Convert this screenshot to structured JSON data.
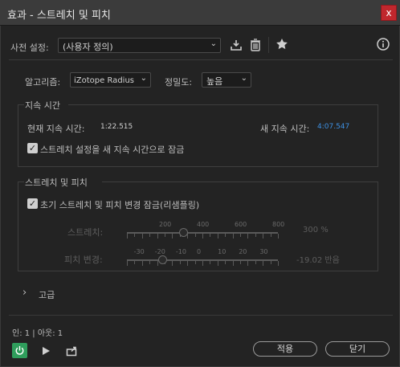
{
  "window": {
    "title": "효과 - 스트레치 및 피치",
    "close_glyph": "x"
  },
  "preset": {
    "label": "사전 설정:",
    "value": "(사용자 정의)"
  },
  "algorithm": {
    "label": "알고리즘:",
    "value": "iZotope Radius"
  },
  "precision": {
    "label": "정밀도:",
    "value": "높음"
  },
  "duration": {
    "group_title": "지속 시간",
    "current_label": "현재 지속 시간:",
    "current_value": "1:22.515",
    "new_label": "새 지속 시간:",
    "new_value": "4:07.547",
    "lock_label": "스트레치 설정을 새 지속 시간으로 잠금",
    "lock_checked": true
  },
  "stretch_pitch": {
    "group_title": "스트레치 및 피치",
    "lock_label": "초기 스트레치 및 피치 변경 잠금(리샘플링)",
    "lock_checked": true,
    "stretch": {
      "label": "스트레치:",
      "scale": [
        "200",
        "400",
        "600",
        "800"
      ],
      "value_text": "300 %",
      "value": 300,
      "min": 0,
      "max": 800
    },
    "pitch": {
      "label": "피치 변경:",
      "scale": [
        "-30",
        "-20",
        "-10",
        "0",
        "10",
        "20",
        "30"
      ],
      "value_text": "-19.02 반음",
      "value": -19.02,
      "min": -36,
      "max": 36
    }
  },
  "advanced": {
    "label": "고급",
    "chevron": "›"
  },
  "io": {
    "label": "인: 1 | 아웃: 1"
  },
  "buttons": {
    "apply": "적용",
    "close": "닫기"
  },
  "colors": {
    "accent_blue": "#3d8fe0",
    "power_green": "#2f9e5c",
    "close_red": "#c0272d"
  }
}
